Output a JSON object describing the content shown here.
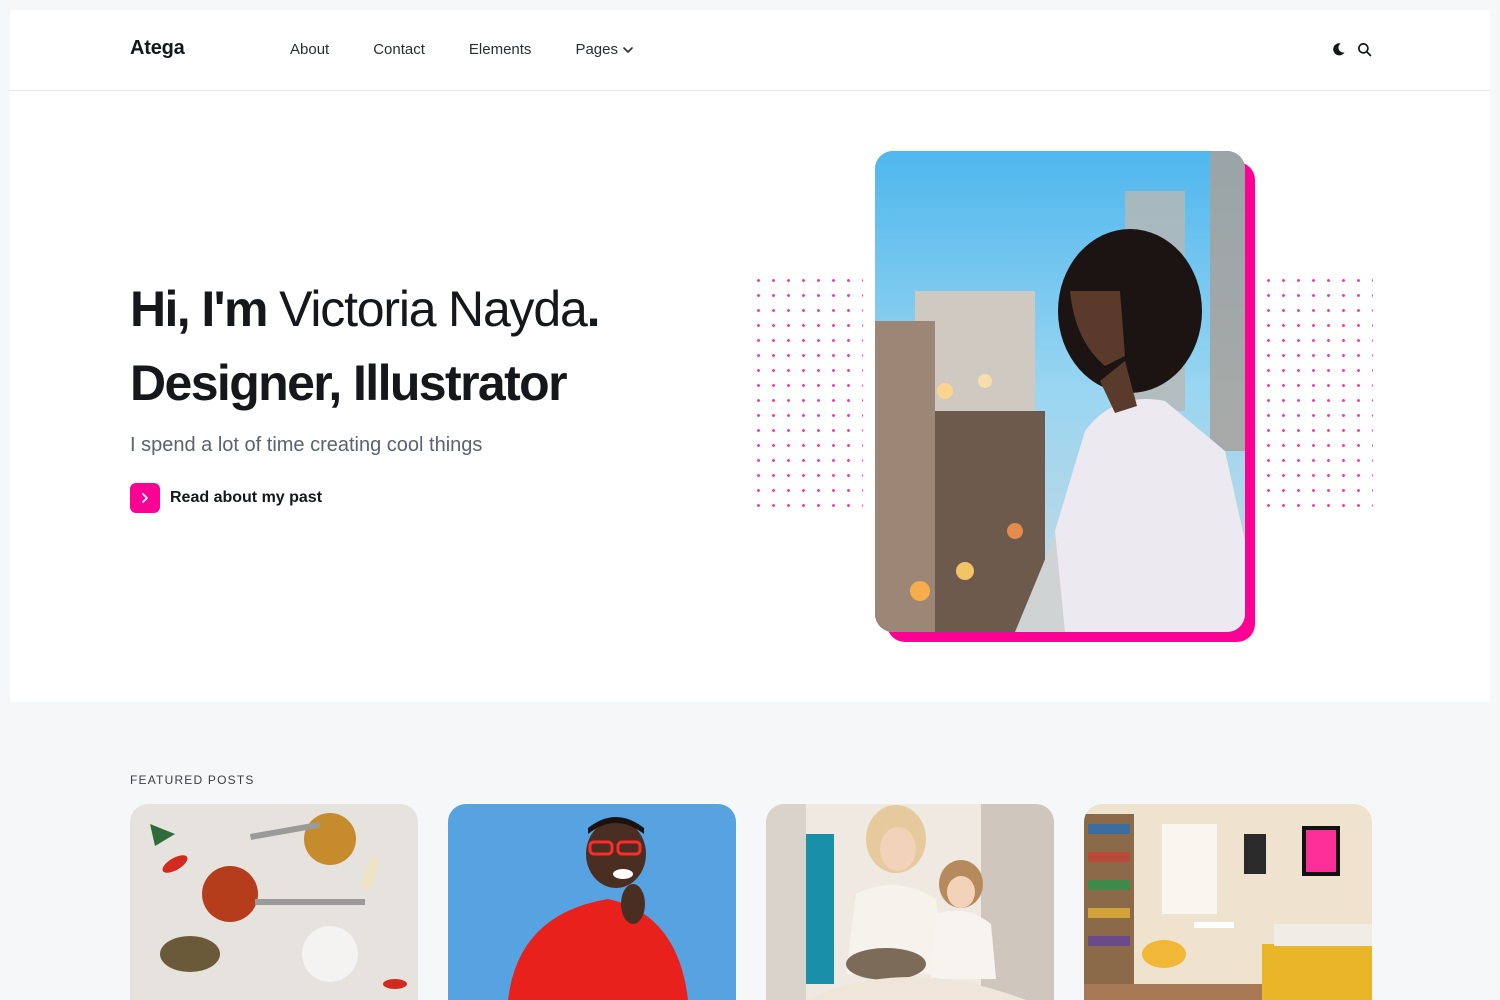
{
  "header": {
    "logo": "Atega",
    "nav": [
      {
        "label": "About"
      },
      {
        "label": "Contact"
      },
      {
        "label": "Elements"
      },
      {
        "label": "Pages"
      }
    ],
    "icons": [
      "moon-icon",
      "search-icon"
    ]
  },
  "hero": {
    "greeting": "Hi, I'm ",
    "name": "Victoria Nayda",
    "period": ".",
    "title_line2": "Designer, Illustrator",
    "subtitle": "I spend a lot of time creating cool things",
    "cta_label": "Read about my past"
  },
  "featured": {
    "label": "FEATURED POSTS"
  },
  "colors": {
    "accent": "#ff0095",
    "highlight": "#fde6f3",
    "text": "#15171a",
    "muted": "#5b6270"
  }
}
